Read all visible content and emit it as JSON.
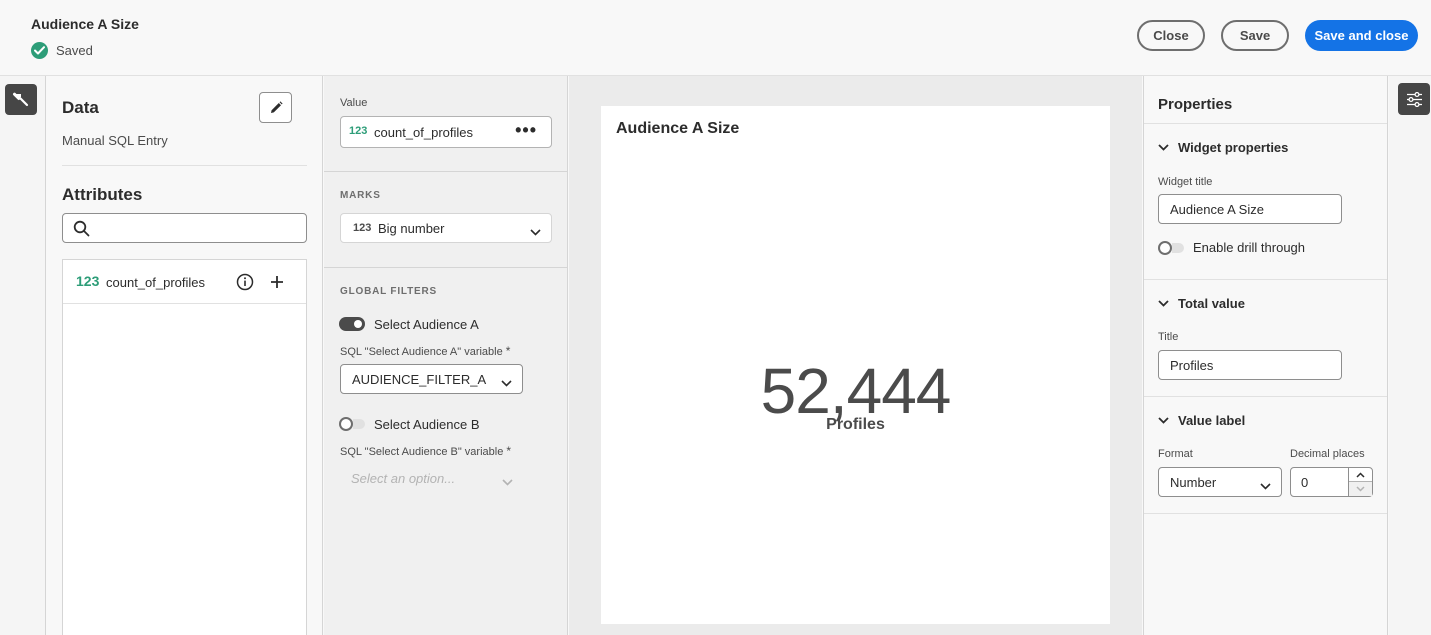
{
  "header": {
    "title": "Audience A Size",
    "status": "Saved",
    "close_label": "Close",
    "save_label": "Save",
    "save_close_label": "Save and close"
  },
  "data_panel": {
    "title": "Data",
    "source": "Manual SQL Entry",
    "attributes_title": "Attributes",
    "search_placeholder": "",
    "attributes": [
      {
        "type_icon": "123",
        "name": "count_of_profiles"
      }
    ]
  },
  "encoding": {
    "value_label": "Value",
    "value_icon": "123",
    "value_field": "count_of_profiles",
    "value_more": "•••",
    "marks_label": "MARKS",
    "marks_icon": "123",
    "marks_value": "Big number",
    "global_filters_label": "GLOBAL FILTERS",
    "filter_a": {
      "label": "Select Audience A",
      "enabled": true,
      "variable_label": "SQL \"Select Audience A\" variable",
      "required_mark": "*",
      "value": "AUDIENCE_FILTER_A"
    },
    "filter_b": {
      "label": "Select Audience B",
      "enabled": false,
      "variable_label": "SQL \"Select Audience B\" variable",
      "required_mark": "*",
      "placeholder": "Select an option..."
    }
  },
  "widget": {
    "title": "Audience A Size",
    "value": "52,444",
    "value_label": "Profiles"
  },
  "properties": {
    "title": "Properties",
    "widget_properties": {
      "heading": "Widget properties",
      "widget_title_label": "Widget title",
      "widget_title_value": "Audience A Size",
      "drill_through_label": "Enable drill through",
      "drill_through_enabled": false
    },
    "total_value": {
      "heading": "Total value",
      "title_label": "Title",
      "title_value": "Profiles"
    },
    "value_label": {
      "heading": "Value label",
      "format_label": "Format",
      "format_value": "Number",
      "decimal_label": "Decimal places",
      "decimal_value": "0"
    }
  },
  "colors": {
    "accent": "#1473e6",
    "success": "#2d9d78",
    "rail_button": "#464646"
  },
  "icons": {
    "left_rail": "hammer-icon",
    "right_rail": "sliders-icon",
    "edit": "pencil-icon",
    "search": "search-icon",
    "info": "info-icon",
    "add": "plus-icon"
  }
}
